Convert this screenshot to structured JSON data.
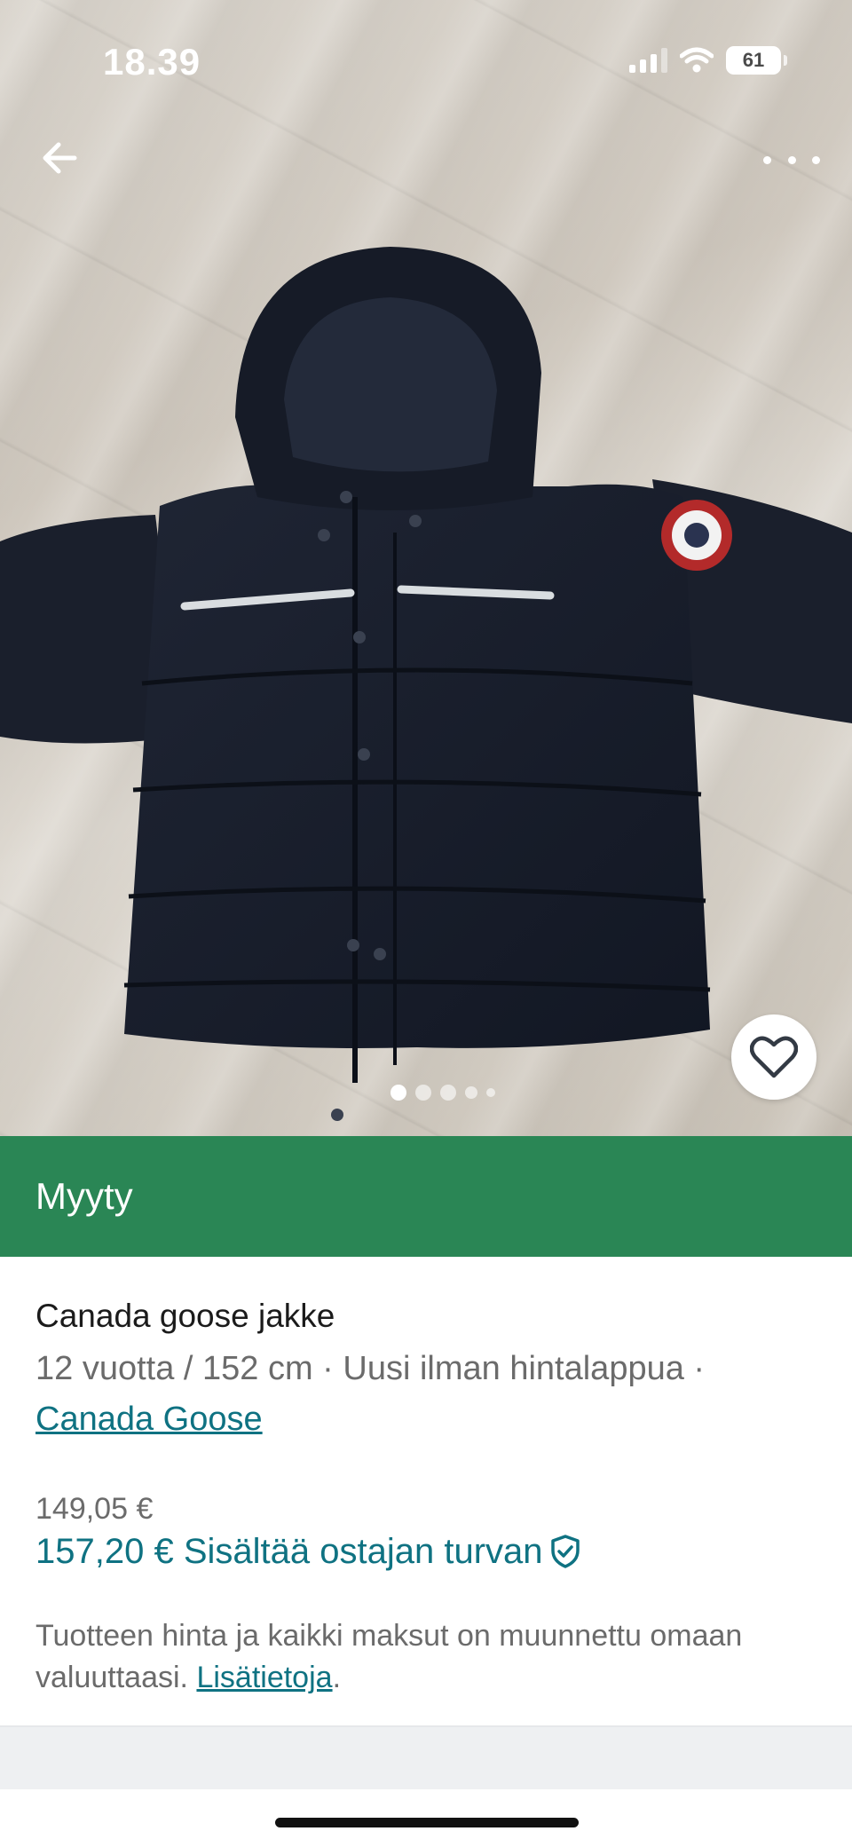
{
  "status_bar": {
    "time": "18.39",
    "battery": "61"
  },
  "product_image": {
    "description_icons": [
      "back-arrow-icon",
      "more-options-icon",
      "heart-icon"
    ],
    "carousel": {
      "current": 1,
      "total": 5
    }
  },
  "banner": {
    "label": "Myyty",
    "color": "#2a8655"
  },
  "item": {
    "title": "Canada goose jakke",
    "meta_text": "12 vuotta / 152 cm · Uusi ilman hintalappua ·",
    "brand": "Canada Goose",
    "price": "149,05 €",
    "total_price_text": "157,20 € Sisältää ostajan turvan",
    "note_text": "Tuotteen hinta ja kaikki maksut on muunnettu omaan valuuttaasi.",
    "note_link": "Lisätietoja",
    "note_end": "."
  },
  "colors": {
    "accent": "#0f7282",
    "text_secondary": "#6b6b6b"
  }
}
